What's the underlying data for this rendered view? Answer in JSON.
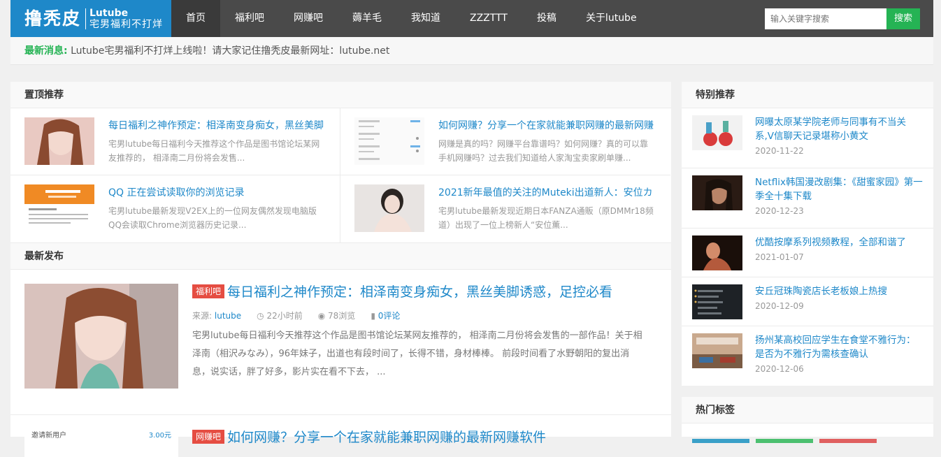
{
  "logo": {
    "main": "撸秃皮",
    "sub1": "Lutube",
    "sub2": "宅男福利不打烊"
  },
  "nav": [
    "首页",
    "福利吧",
    "网赚吧",
    "薅羊毛",
    "我知道",
    "ZZZTTT",
    "投稿",
    "关于lutube"
  ],
  "search": {
    "placeholder": "输入关键字搜索",
    "button": "搜索"
  },
  "news": {
    "label": "最新消息:",
    "text": "Lutube宅男福利不打烊上线啦！请大家记住撸秃皮最新网址：lutube.net"
  },
  "pinned": {
    "title": "置顶推荐",
    "items": [
      {
        "title": "每日福利之神作预定：相泽南变身痴女，黑丝美脚",
        "desc": "宅男lutube每日福利今天推荐这个作品是图书馆论坛某网友推荐的， 相泽南二月份将会发售..."
      },
      {
        "title": "如何网赚？分享一个在家就能兼职网赚的最新网赚",
        "desc": "网赚是真的吗？网赚平台靠谱吗？如何网赚？真的可以靠手机网赚吗？过去我们知道给人家淘宝卖家刷单赚..."
      },
      {
        "title": "QQ 正在尝试读取你的浏览记录",
        "desc": "宅男lutube最新发现V2EX上的一位网友偶然发现电脑版QQ会读取Chrome浏览器历史记录..."
      },
      {
        "title": "2021新年最值的关注的Muteki出道新人：安位カ",
        "desc": "宅男lutube最新发现近期日本FANZA通販（原DMMr18频道）出现了一位上榜新人“安位薫..."
      }
    ]
  },
  "latest": {
    "title": "最新发布",
    "post": {
      "category": "福利吧",
      "title": "每日福利之神作预定：相泽南变身痴女，黑丝美脚诱惑，足控必看",
      "source_label": "来源:",
      "source": "lutube",
      "time": "22小时前",
      "views": "78浏览",
      "comments": "0评论",
      "excerpt": "宅男lutube每日福利今天推荐这个作品是图书馆论坛某网友推荐的， 相泽南二月份将会发售的一部作品！关于相泽南（相沢みなみ），96年妹子，出道也有段时间了，长得不错，身材棒棒。 前段时间看了水野朝阳的复出消息，说实话，胖了好多，影片实在看不下去， ..."
    },
    "post2": {
      "category": "网赚吧",
      "title": "如何网赚？分享一个在家就能兼职网赚的最新网赚软件",
      "thumb_label": "邀请新用户",
      "thumb_value": "3.00元"
    }
  },
  "special": {
    "title": "特别推荐",
    "items": [
      {
        "title": "网曝太原某学院老师与同事有不当关系,V信聊天记录堪称小黄文",
        "date": "2020-11-22"
      },
      {
        "title": "Netflix韩国漫改剧集：《甜蜜家园》第一季全十集下载",
        "date": "2020-12-23"
      },
      {
        "title": "优酷按摩系列视频教程，全部和谐了",
        "date": "2021-01-07"
      },
      {
        "title": "安丘冠珠陶瓷店长老板娘上热搜",
        "date": "2020-12-09"
      },
      {
        "title": "扬州某高校回应学生在食堂不雅行为：是否为不雅行为需核查确认",
        "date": "2020-12-06"
      }
    ]
  },
  "hot_tags": {
    "title": "热门标签"
  },
  "colors": {
    "brand": "#1e88c9",
    "green": "#25b354",
    "badge": "#e54d42"
  }
}
